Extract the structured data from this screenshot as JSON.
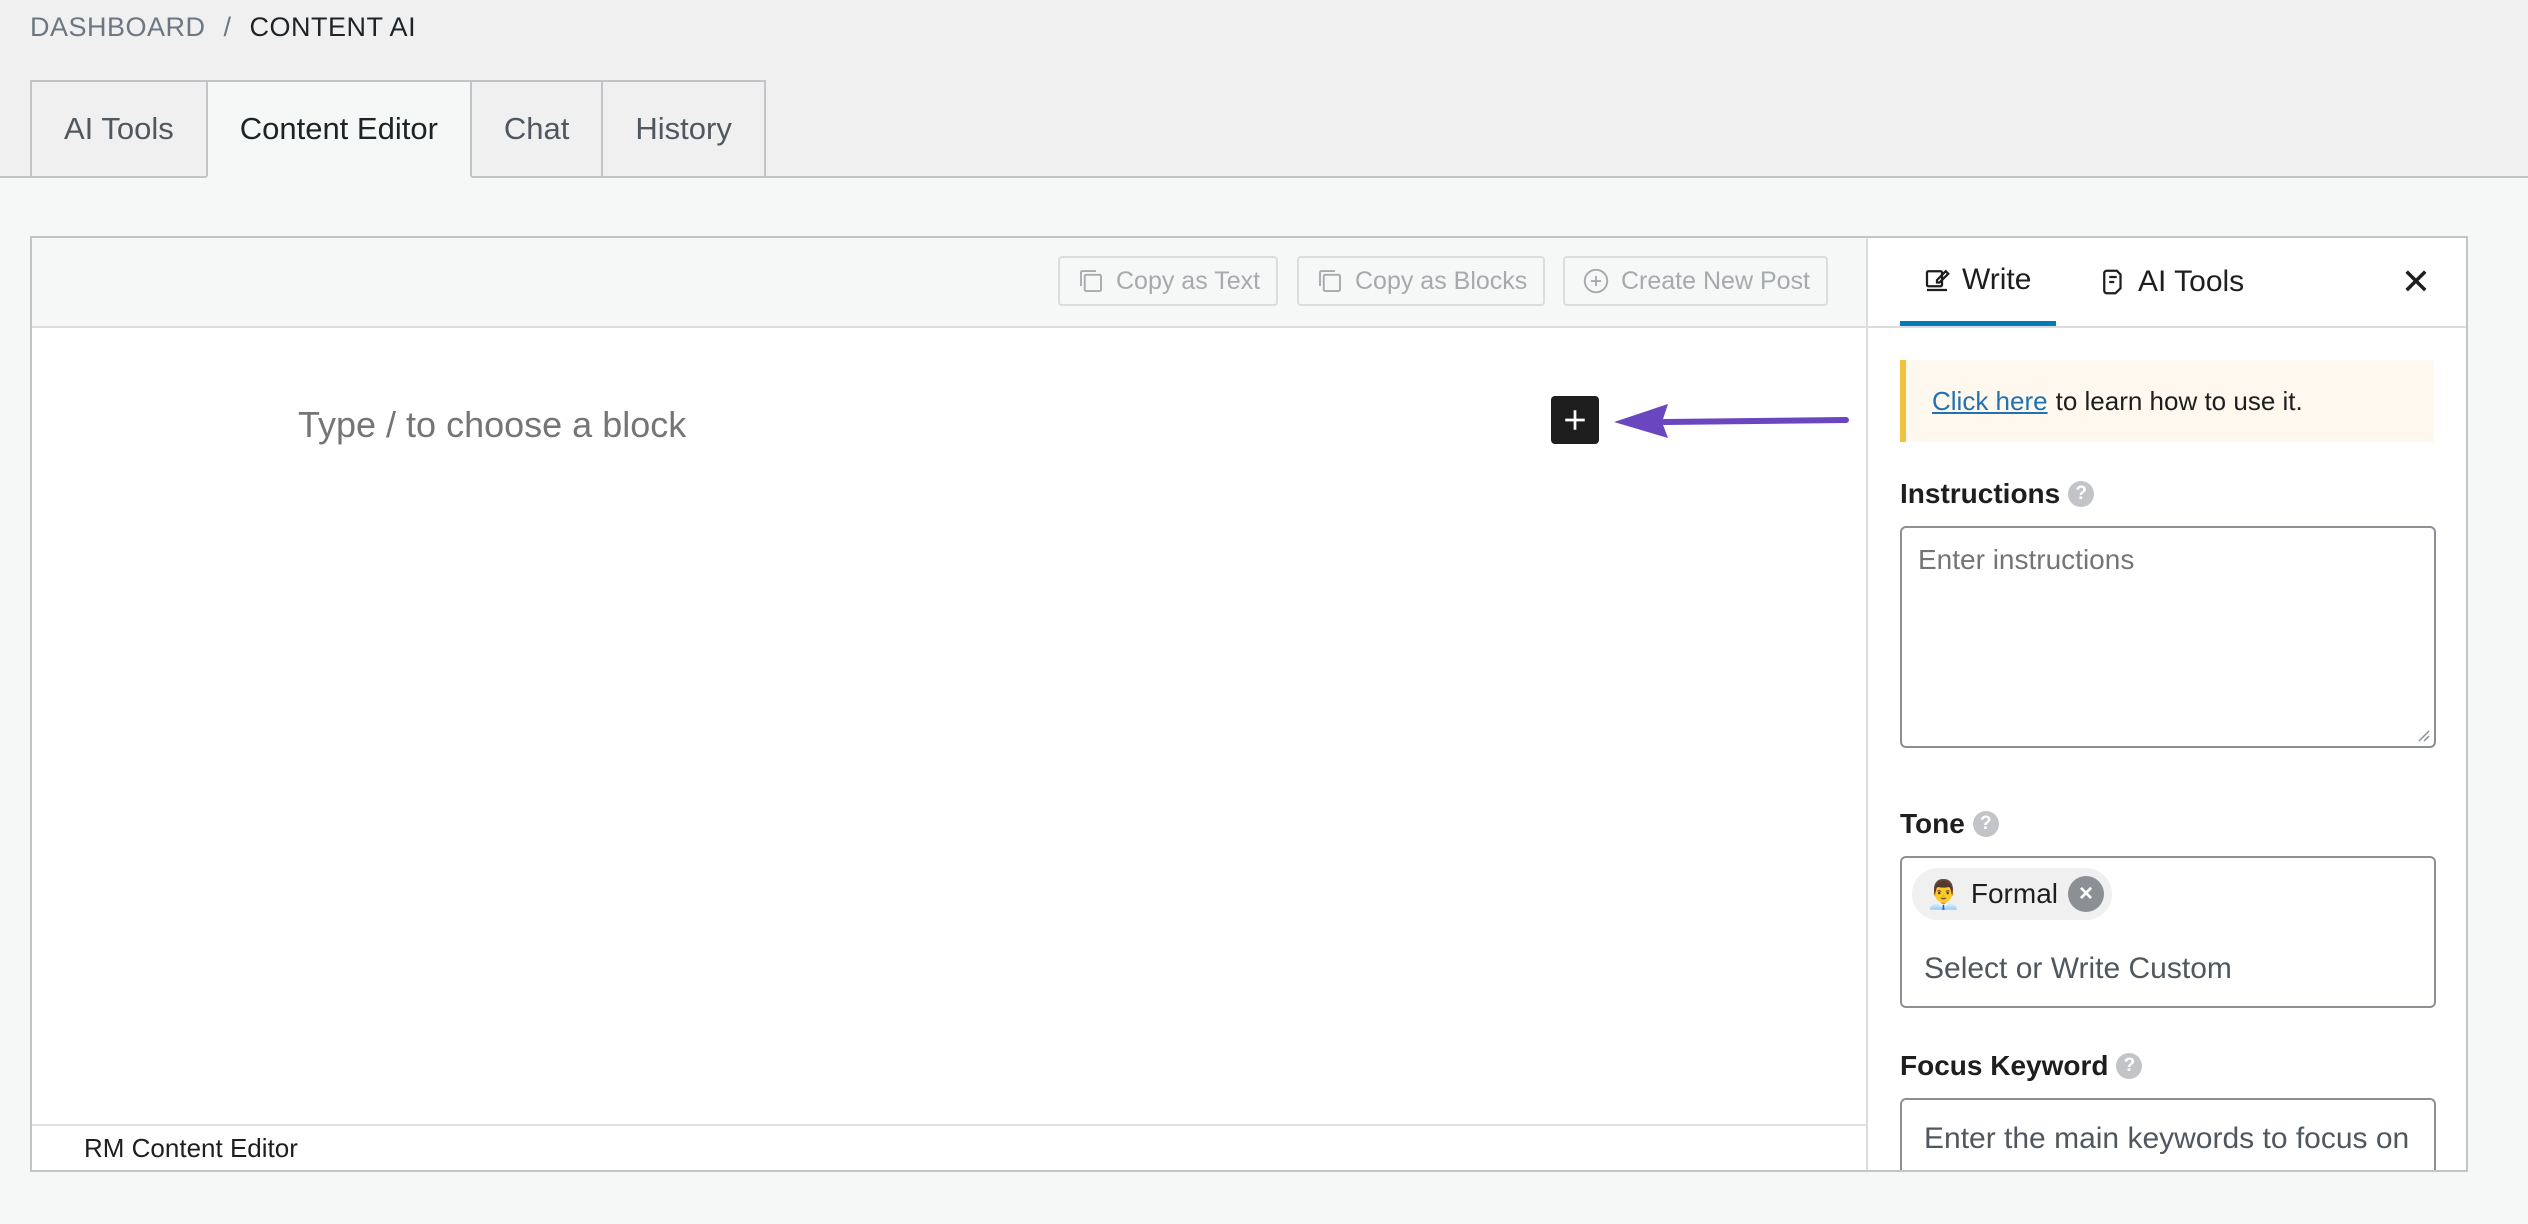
{
  "breadcrumb": {
    "home": "DASHBOARD",
    "separator": "/",
    "current": "CONTENT AI"
  },
  "tabs": [
    {
      "label": "AI Tools",
      "active": false
    },
    {
      "label": "Content Editor",
      "active": true
    },
    {
      "label": "Chat",
      "active": false
    },
    {
      "label": "History",
      "active": false
    }
  ],
  "toolbar": {
    "copy_text": "Copy as Text",
    "copy_blocks": "Copy as Blocks",
    "create_post": "Create New Post"
  },
  "editor": {
    "placeholder": "Type / to choose a block",
    "footer": "RM Content Editor"
  },
  "sidebar": {
    "tabs": [
      {
        "label": "Write",
        "icon": "edit-icon",
        "active": true
      },
      {
        "label": "AI Tools",
        "icon": "ai-tools-icon",
        "active": false
      }
    ],
    "close": "✕",
    "notice": {
      "link": "Click here",
      "text": "to learn how to use it."
    },
    "instructions": {
      "label": "Instructions",
      "placeholder": "Enter instructions"
    },
    "tone": {
      "label": "Tone",
      "selected": "Formal",
      "chip_icon": "👨‍💼",
      "placeholder": "Select or Write Custom"
    },
    "focus_keyword": {
      "label": "Focus Keyword",
      "placeholder": "Enter the main keywords to focus on"
    },
    "help": "?"
  },
  "colors": {
    "accent": "#007cba",
    "arrow": "#6b46c1",
    "notice_border": "#f0c33c"
  }
}
